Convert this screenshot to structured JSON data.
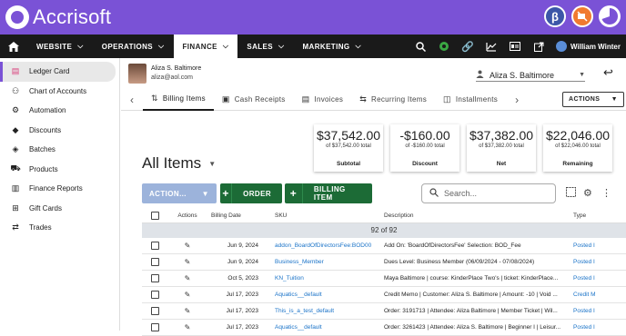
{
  "app": {
    "name": "Accrisoft"
  },
  "nav": {
    "items": [
      {
        "label": "WEBSITE"
      },
      {
        "label": "OPERATIONS"
      },
      {
        "label": "FINANCE"
      },
      {
        "label": "SALES"
      },
      {
        "label": "MARKETING"
      }
    ],
    "user": "William Winter"
  },
  "sidebar": {
    "items": [
      {
        "label": "Ledger Card",
        "icon": "ledger-card-icon"
      },
      {
        "label": "Chart of Accounts",
        "icon": "chart-of-accounts-icon"
      },
      {
        "label": "Automation",
        "icon": "robot-icon"
      },
      {
        "label": "Discounts",
        "icon": "tag-icon"
      },
      {
        "label": "Batches",
        "icon": "layers-icon"
      },
      {
        "label": "Products",
        "icon": "cart-icon"
      },
      {
        "label": "Finance Reports",
        "icon": "bar-chart-icon"
      },
      {
        "label": "Gift Cards",
        "icon": "gift-icon"
      },
      {
        "label": "Trades",
        "icon": "swap-icon"
      }
    ]
  },
  "customer": {
    "name": "Aliza S. Baltimore",
    "email": "aliza@aol.com"
  },
  "user_select": {
    "value": "Aliza S. Baltimore"
  },
  "tabs": [
    {
      "label": "Billing Items"
    },
    {
      "label": "Cash Receipts"
    },
    {
      "label": "Invoices"
    },
    {
      "label": "Recurring Items"
    },
    {
      "label": "Installments"
    }
  ],
  "actions_label": "ACTIONS",
  "summary": [
    {
      "value": "$37,542.00",
      "sub": "of $37,542.00 total",
      "label": "Subtotal"
    },
    {
      "value": "-$160.00",
      "sub": "of -$160.00 total",
      "label": "Discount"
    },
    {
      "value": "$37,382.00",
      "sub": "of $37,382.00 total",
      "label": "Net"
    },
    {
      "value": "$22,046.00",
      "sub": "of $22,046.00 total",
      "label": "Remaining"
    }
  ],
  "list_title": "All Items",
  "toolbar": {
    "action_label": "ACTION...",
    "order_label": "ORDER",
    "billing_item_label": "BILLING ITEM",
    "search_placeholder": "Search..."
  },
  "table": {
    "headers": {
      "actions": "Actions",
      "date": "Billing Date",
      "sku": "SKU",
      "desc": "Description",
      "type": "Type"
    },
    "count": "92 of 92",
    "rows": [
      {
        "date": "Jun 9, 2024",
        "sku": "addon_BoardOfDirectorsFee:BOD00",
        "desc": "Add On: 'BoardOfDirectorsFee' Selection: BOD_Fee",
        "type": "Posted I"
      },
      {
        "date": "Jun 9, 2024",
        "sku": "Business_Member",
        "desc": "Dues Level: Business Member (06/09/2024 - 07/08/2024)",
        "type": "Posted I"
      },
      {
        "date": "Oct 5, 2023",
        "sku": "KN_Tuition",
        "desc": "Maya Baltimore | course: KinderPlace Two's | ticket: KinderPlace...",
        "type": "Posted I"
      },
      {
        "date": "Jul 17, 2023",
        "sku": "Aquatics__default",
        "desc": "Credit Memo | Customer: Aliza S. Baltimore | Amount: -10 | Void ...",
        "type": "Credit M"
      },
      {
        "date": "Jul 17, 2023",
        "sku": "This_is_a_test_default",
        "desc": "Order: 3191713 | Attendee: Aliza Baltimore | Member Ticket | Wil...",
        "type": "Posted I"
      },
      {
        "date": "Jul 17, 2023",
        "sku": "Aquatics__default",
        "desc": "Order: 3261423 | Attendee: Aliza S. Baltimore | Beginner I | Leisur...",
        "type": "Posted I"
      }
    ]
  }
}
